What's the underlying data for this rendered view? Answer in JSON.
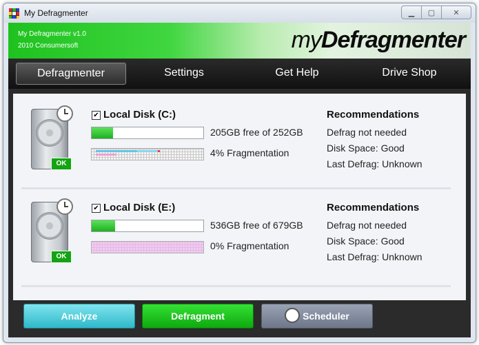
{
  "window": {
    "title": "My Defragmenter"
  },
  "banner": {
    "version": "My Defragmenter v1.0",
    "company": "2010 Consumersoft",
    "logo_prefix": "my",
    "logo_main": "Defragmenter"
  },
  "nav": {
    "tabs": [
      {
        "label": "Defragmenter",
        "active": true
      },
      {
        "label": "Settings",
        "active": false
      },
      {
        "label": "Get Help",
        "active": false
      },
      {
        "label": "Drive Shop",
        "active": false
      }
    ]
  },
  "disks": [
    {
      "name": "Local Disk (C:)",
      "checked": true,
      "status_badge": "OK",
      "space_text": "205GB free of 252GB",
      "frag_text": "4% Fragmentation",
      "rec_title": "Recommendations",
      "rec_lines": [
        "Defrag not needed",
        "Disk Space: Good",
        "Last Defrag: Unknown"
      ]
    },
    {
      "name": "Local Disk (E:)",
      "checked": true,
      "status_badge": "OK",
      "space_text": "536GB free of 679GB",
      "frag_text": "0% Fragmentation",
      "rec_title": "Recommendations",
      "rec_lines": [
        "Defrag not needed",
        "Disk Space: Good",
        "Last Defrag: Unknown"
      ]
    }
  ],
  "buttons": {
    "analyze": "Analyze",
    "defragment": "Defragment",
    "scheduler": "Scheduler"
  },
  "colors": {
    "accent_green": "#1ec21e",
    "analyze_cyan": "#2fb8c9",
    "scheduler_gray": "#6e778a"
  }
}
